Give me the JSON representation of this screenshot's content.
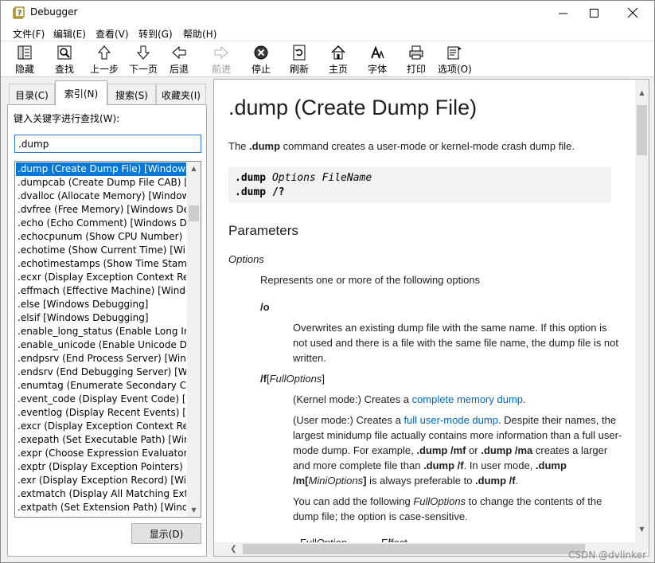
{
  "window": {
    "title": "Debugger"
  },
  "menu": {
    "items": [
      "文件(F)",
      "编辑(E)",
      "查看(V)",
      "转到(G)",
      "帮助(H)"
    ]
  },
  "toolbar": {
    "buttons": [
      {
        "label": "隐藏",
        "icon": "hide-icon"
      },
      {
        "label": "查找",
        "icon": "find-icon"
      },
      {
        "label": "上一步",
        "icon": "up-arrow-icon"
      },
      {
        "label": "下一页",
        "icon": "down-arrow-icon"
      },
      {
        "label": "后退",
        "icon": "back-arrow-icon"
      },
      {
        "label": "前进",
        "icon": "forward-arrow-icon",
        "disabled": true
      },
      {
        "label": "停止",
        "icon": "stop-icon"
      },
      {
        "label": "刷新",
        "icon": "refresh-icon"
      },
      {
        "label": "主页",
        "icon": "home-icon"
      },
      {
        "label": "字体",
        "icon": "font-icon"
      },
      {
        "label": "打印",
        "icon": "print-icon"
      },
      {
        "label": "选项(O)",
        "icon": "options-icon"
      }
    ]
  },
  "left": {
    "tabs": [
      "目录(C)",
      "索引(N)",
      "搜索(S)",
      "收藏夹(I)"
    ],
    "active_tab": "索引(N)",
    "keyword_label": "键入关键字进行查找(W):",
    "keyword_value": ".dump",
    "show_button": "显示(D)",
    "list": [
      ".dump (Create Dump File) [Windows",
      ".dumpcab (Create Dump File CAB) [W",
      ".dvalloc (Allocate Memory) [Window",
      ".dvfree (Free Memory) [Windows De",
      ".echo (Echo Comment) [Windows De",
      ".echocpunum (Show CPU Number) [W",
      ".echotime (Show Current Time) [Win",
      ".echotimestamps (Show Time Stamp",
      ".ecxr (Display Exception Context Rec",
      ".effmach (Effective Machine) [Windo",
      ".else [Windows Debugging]",
      ".elsif [Windows Debugging]",
      ".enable_long_status (Enable Long Int",
      ".enable_unicode (Enable Unicode Dis",
      ".endpsrv (End Process Server) [Wind",
      ".endsrv (End Debugging Server) [Wi",
      ".enumtag (Enumerate Secondary Cal",
      ".event_code (Display Event Code) [W",
      ".eventlog (Display Recent Events) [W",
      ".excr (Display Exception Context Rec",
      ".exepath (Set Executable Path) [Wind",
      ".expr (Choose Expression Evaluator)",
      ".exptr (Display Exception Pointers) [W",
      ".exr (Display Exception Record) [Win",
      ".extmatch (Display All Matching Exte",
      ".extpath (Set Extension Path) [Windo"
    ]
  },
  "doc": {
    "title": ".dump (Create Dump File)",
    "intro_pre": "The ",
    "intro_cmd": ".dump",
    "intro_post": " command creates a user-mode or kernel-mode crash dump file.",
    "code_line1_cmd": ".dump",
    "code_line1_args": " Options FileName",
    "code_line2": ".dump /?",
    "parameters_heading": "Parameters",
    "options_label": "Options",
    "options_desc": "Represents one or more of the following options",
    "o_flag": "/o",
    "o_desc": "Overwrites an existing dump file with the same name. If this option is not used and there is a file with the same file name, the dump file is not written.",
    "f_flag": "/f",
    "f_bracket_open": "[",
    "f_fulloptions": "FullOptions",
    "f_bracket_close": "]",
    "kernel_pre": "(Kernel mode:) Creates a ",
    "kernel_link": "complete memory dump",
    "kernel_post": ".",
    "user_pre": "(User mode:) Creates a ",
    "user_link": "full user-mode dump",
    "user_mid1": ". Despite their names, the largest minidump file actually contains more information than a full user-mode dump. For example, ",
    "user_cmd1": ".dump /mf",
    "user_or": " or ",
    "user_cmd2": ".dump /ma",
    "user_mid2": " creates a larger and more complete file than ",
    "user_cmd3": ".dump /f",
    "user_mid3": ". In user mode, ",
    "user_cmd4": ".dump /m[",
    "user_miniopts": "MiniOptions",
    "user_cmd4_close": "]",
    "user_mid4": " is always preferable to ",
    "user_cmd5": ".dump /f",
    "user_end": ".",
    "add_pre": "You can add the following ",
    "add_fullopts": "FullOptions",
    "add_post": " to change the contents of the dump file; the option is case-sensitive.",
    "table_col1": "FullOption",
    "table_col2": "Effect"
  },
  "watermark": "CSDN @dvlinker"
}
